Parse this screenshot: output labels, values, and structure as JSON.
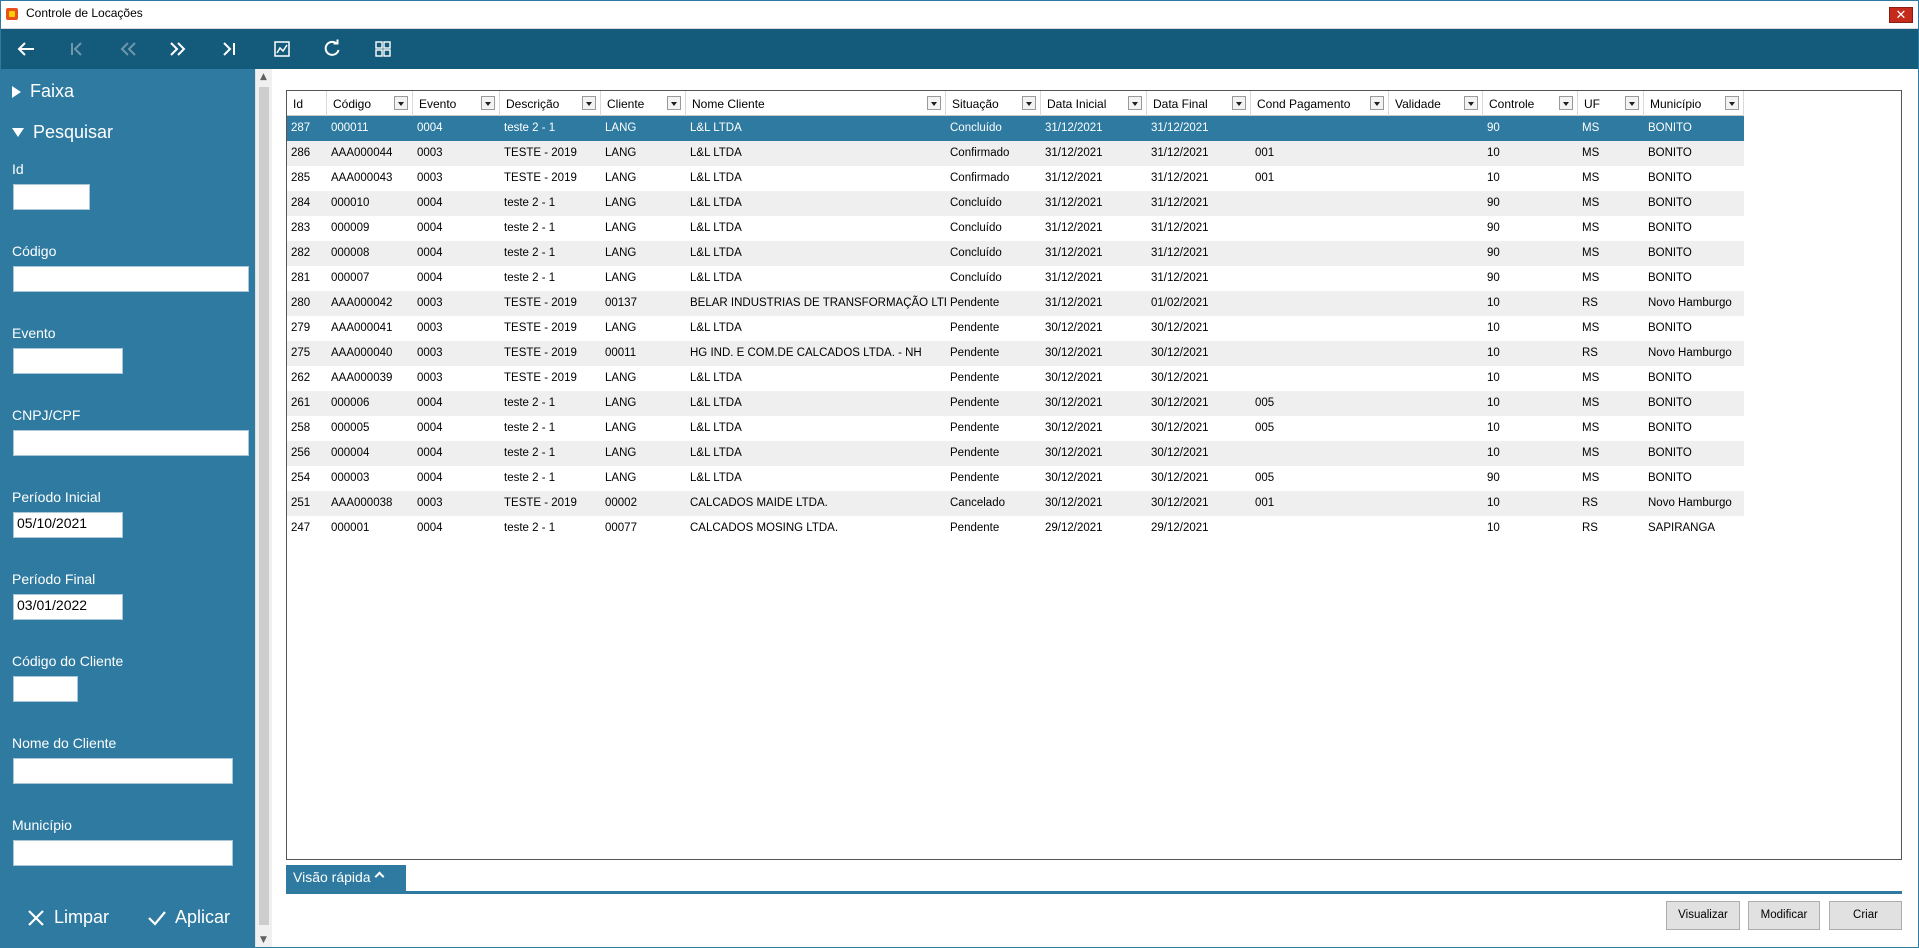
{
  "window": {
    "title": "Controle de Locações",
    "close_glyph": "✕"
  },
  "colors": {
    "primary": "#2e7aa0",
    "toolbar": "#145a7a",
    "row_alt": "#efefef",
    "selected_row": "#2e7aa0"
  },
  "toolbar": {
    "icons": [
      "back-arrow-icon",
      "first-record-icon",
      "previous-page-icon",
      "next-page-icon",
      "last-record-icon",
      "chart-icon",
      "refresh-icon",
      "layout-grid-icon"
    ]
  },
  "sidebar": {
    "faixa_label": "Faixa",
    "pesquisar_label": "Pesquisar",
    "fields": {
      "id": {
        "label": "Id",
        "value": ""
      },
      "codigo": {
        "label": "Código",
        "value": ""
      },
      "evento": {
        "label": "Evento",
        "value": ""
      },
      "cnpj": {
        "label": "CNPJ/CPF",
        "value": ""
      },
      "periodo_inicial": {
        "label": "Período Inicial",
        "value": "05/10/2021"
      },
      "periodo_final": {
        "label": "Período Final",
        "value": "03/01/2022"
      },
      "codigo_cliente": {
        "label": "Código do Cliente",
        "value": ""
      },
      "nome_cliente": {
        "label": "Nome do Cliente",
        "value": ""
      },
      "municipio": {
        "label": "Município",
        "value": ""
      }
    },
    "limpar_label": "Limpar",
    "aplicar_label": "Aplicar"
  },
  "grid": {
    "columns": [
      "Id",
      "Código",
      "Evento",
      "Descrição",
      "Cliente",
      "Nome Cliente",
      "Situação",
      "Data Inicial",
      "Data Final",
      "Cond Pagamento",
      "Validade",
      "Controle",
      "UF",
      "Município"
    ],
    "rows": [
      [
        "287",
        "000011",
        "0004",
        "teste 2 - 1",
        "LANG",
        "L&L LTDA",
        "Concluído",
        "31/12/2021",
        "31/12/2021",
        "",
        "",
        "90",
        "MS",
        "BONITO"
      ],
      [
        "286",
        "AAA000044",
        "0003",
        "TESTE - 2019",
        "LANG",
        "L&L LTDA",
        "Confirmado",
        "31/12/2021",
        "31/12/2021",
        "001",
        "",
        "10",
        "MS",
        "BONITO"
      ],
      [
        "285",
        "AAA000043",
        "0003",
        "TESTE - 2019",
        "LANG",
        "L&L LTDA",
        "Confirmado",
        "31/12/2021",
        "31/12/2021",
        "001",
        "",
        "10",
        "MS",
        "BONITO"
      ],
      [
        "284",
        "000010",
        "0004",
        "teste 2 - 1",
        "LANG",
        "L&L LTDA",
        "Concluído",
        "31/12/2021",
        "31/12/2021",
        "",
        "",
        "90",
        "MS",
        "BONITO"
      ],
      [
        "283",
        "000009",
        "0004",
        "teste 2 - 1",
        "LANG",
        "L&L LTDA",
        "Concluído",
        "31/12/2021",
        "31/12/2021",
        "",
        "",
        "90",
        "MS",
        "BONITO"
      ],
      [
        "282",
        "000008",
        "0004",
        "teste 2 - 1",
        "LANG",
        "L&L LTDA",
        "Concluído",
        "31/12/2021",
        "31/12/2021",
        "",
        "",
        "90",
        "MS",
        "BONITO"
      ],
      [
        "281",
        "000007",
        "0004",
        "teste 2 - 1",
        "LANG",
        "L&L LTDA",
        "Concluído",
        "31/12/2021",
        "31/12/2021",
        "",
        "",
        "90",
        "MS",
        "BONITO"
      ],
      [
        "280",
        "AAA000042",
        "0003",
        "TESTE - 2019",
        "00137",
        "BELAR INDUSTRIAS DE TRANSFORMAÇÃO LTDA",
        "Pendente",
        "31/12/2021",
        "01/02/2021",
        "",
        "",
        "10",
        "RS",
        "Novo Hamburgo"
      ],
      [
        "279",
        "AAA000041",
        "0003",
        "TESTE - 2019",
        "LANG",
        "L&L LTDA",
        "Pendente",
        "30/12/2021",
        "30/12/2021",
        "",
        "",
        "10",
        "MS",
        "BONITO"
      ],
      [
        "275",
        "AAA000040",
        "0003",
        "TESTE - 2019",
        "00011",
        "HG IND. E COM.DE CALCADOS LTDA. - NH",
        "Pendente",
        "30/12/2021",
        "30/12/2021",
        "",
        "",
        "10",
        "RS",
        "Novo Hamburgo"
      ],
      [
        "262",
        "AAA000039",
        "0003",
        "TESTE - 2019",
        "LANG",
        "L&L LTDA",
        "Pendente",
        "30/12/2021",
        "30/12/2021",
        "",
        "",
        "10",
        "MS",
        "BONITO"
      ],
      [
        "261",
        "000006",
        "0004",
        "teste 2 - 1",
        "LANG",
        "L&L LTDA",
        "Pendente",
        "30/12/2021",
        "30/12/2021",
        "005",
        "",
        "10",
        "MS",
        "BONITO"
      ],
      [
        "258",
        "000005",
        "0004",
        "teste 2 - 1",
        "LANG",
        "L&L LTDA",
        "Pendente",
        "30/12/2021",
        "30/12/2021",
        "005",
        "",
        "10",
        "MS",
        "BONITO"
      ],
      [
        "256",
        "000004",
        "0004",
        "teste 2 - 1",
        "LANG",
        "L&L LTDA",
        "Pendente",
        "30/12/2021",
        "30/12/2021",
        "",
        "",
        "10",
        "MS",
        "BONITO"
      ],
      [
        "254",
        "000003",
        "0004",
        "teste 2 - 1",
        "LANG",
        "L&L LTDA",
        "Pendente",
        "30/12/2021",
        "30/12/2021",
        "005",
        "",
        "90",
        "MS",
        "BONITO"
      ],
      [
        "251",
        "AAA000038",
        "0003",
        "TESTE - 2019",
        "00002",
        "CALCADOS MAIDE LTDA.",
        "Cancelado",
        "30/12/2021",
        "30/12/2021",
        "001",
        "",
        "10",
        "RS",
        "Novo Hamburgo"
      ],
      [
        "247",
        "000001",
        "0004",
        "teste 2 - 1",
        "00077",
        "CALCADOS MOSING LTDA.",
        "Pendente",
        "29/12/2021",
        "29/12/2021",
        "",
        "",
        "10",
        "RS",
        "SAPIRANGA"
      ]
    ],
    "selected_row": 0
  },
  "quick_view": {
    "label": "Visão rápida"
  },
  "buttons": {
    "visualizar": "Visualizar",
    "modificar": "Modificar",
    "criar": "Criar"
  }
}
